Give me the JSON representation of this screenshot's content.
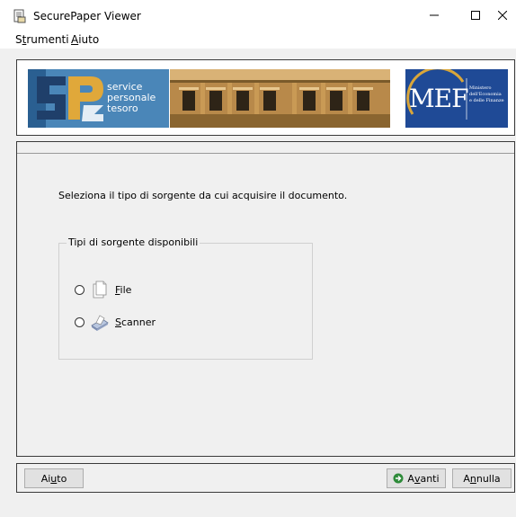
{
  "window": {
    "title": "SecurePaper Viewer"
  },
  "menu": {
    "strumenti": {
      "label_first": "S",
      "label_ul": "t",
      "label_rest": "rumenti"
    },
    "aiuto": {
      "label_ul": "A",
      "label_rest": "iuto"
    }
  },
  "banner": {
    "spt_lines": [
      "service",
      "personale",
      "tesoro"
    ],
    "mef_mark": "MEF",
    "mef_sub": [
      "Ministero",
      "dell'Economia",
      "e delle Finanze"
    ]
  },
  "content": {
    "instruction": "Seleziona il tipo di sorgente da cui acquisire il documento.",
    "group_legend": "Tipi di sorgente disponibili",
    "options": [
      {
        "name": "file",
        "label_ul": "F",
        "label_rest": "ile",
        "icon": "document-file-icon",
        "selected": false
      },
      {
        "name": "scanner",
        "label_ul": "S",
        "label_rest": "canner",
        "icon": "scanner-icon",
        "selected": false
      }
    ]
  },
  "buttons": {
    "aiuto": {
      "label_before": "Ai",
      "label_ul": "u",
      "label_after": "to"
    },
    "avanti": {
      "label_before": "A",
      "label_ul": "v",
      "label_after": "anti",
      "icon": "go-arrow-icon"
    },
    "annulla": {
      "label_before": "A",
      "label_ul": "n",
      "label_after": "nulla"
    }
  },
  "colors": {
    "spt_blue": "#4a86b8",
    "mef_blue": "#1f4a96",
    "go_green": "#2e8b3a"
  }
}
